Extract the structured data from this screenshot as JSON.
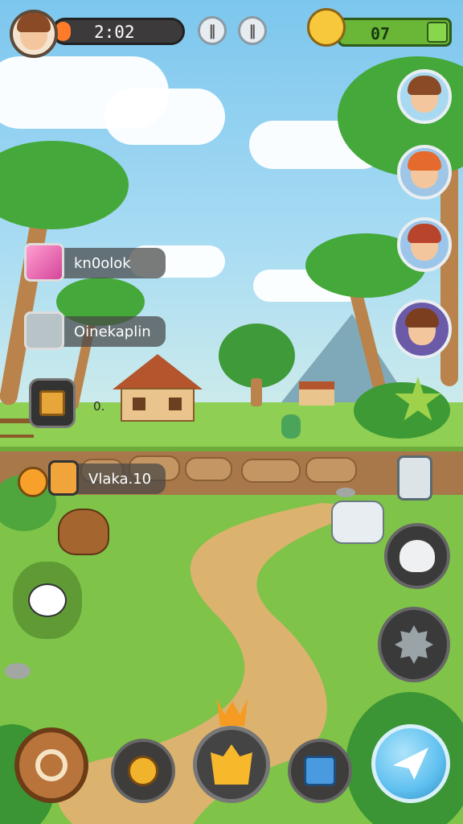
{
  "hud": {
    "timer": "2:02",
    "timer_progress": 0.12,
    "pause_left": "‖",
    "pause_right": "‖",
    "coin_count": "07"
  },
  "side_avatars": [
    "girl-brown-hair",
    "boy-orange-hair",
    "girl-red-hair",
    "woman-purple-shirt"
  ],
  "labels": {
    "item1": "kn0olok",
    "item2": "Oinekaplin",
    "item3": "Vlaka.10"
  },
  "small_text": "0.",
  "colors": {
    "timer_fill": "#ff7b29",
    "coin_bar": "#6ab637",
    "accent_blue": "#5ec0ef"
  },
  "bottom_bar": {
    "buttons": [
      "target-icon",
      "sun-creature-icon",
      "crown-gem-icon",
      "map-card-icon",
      "paper-plane-icon"
    ]
  },
  "right_controls": [
    "ghost-icon",
    "gear-icon"
  ],
  "left_control": "sheep-icon"
}
